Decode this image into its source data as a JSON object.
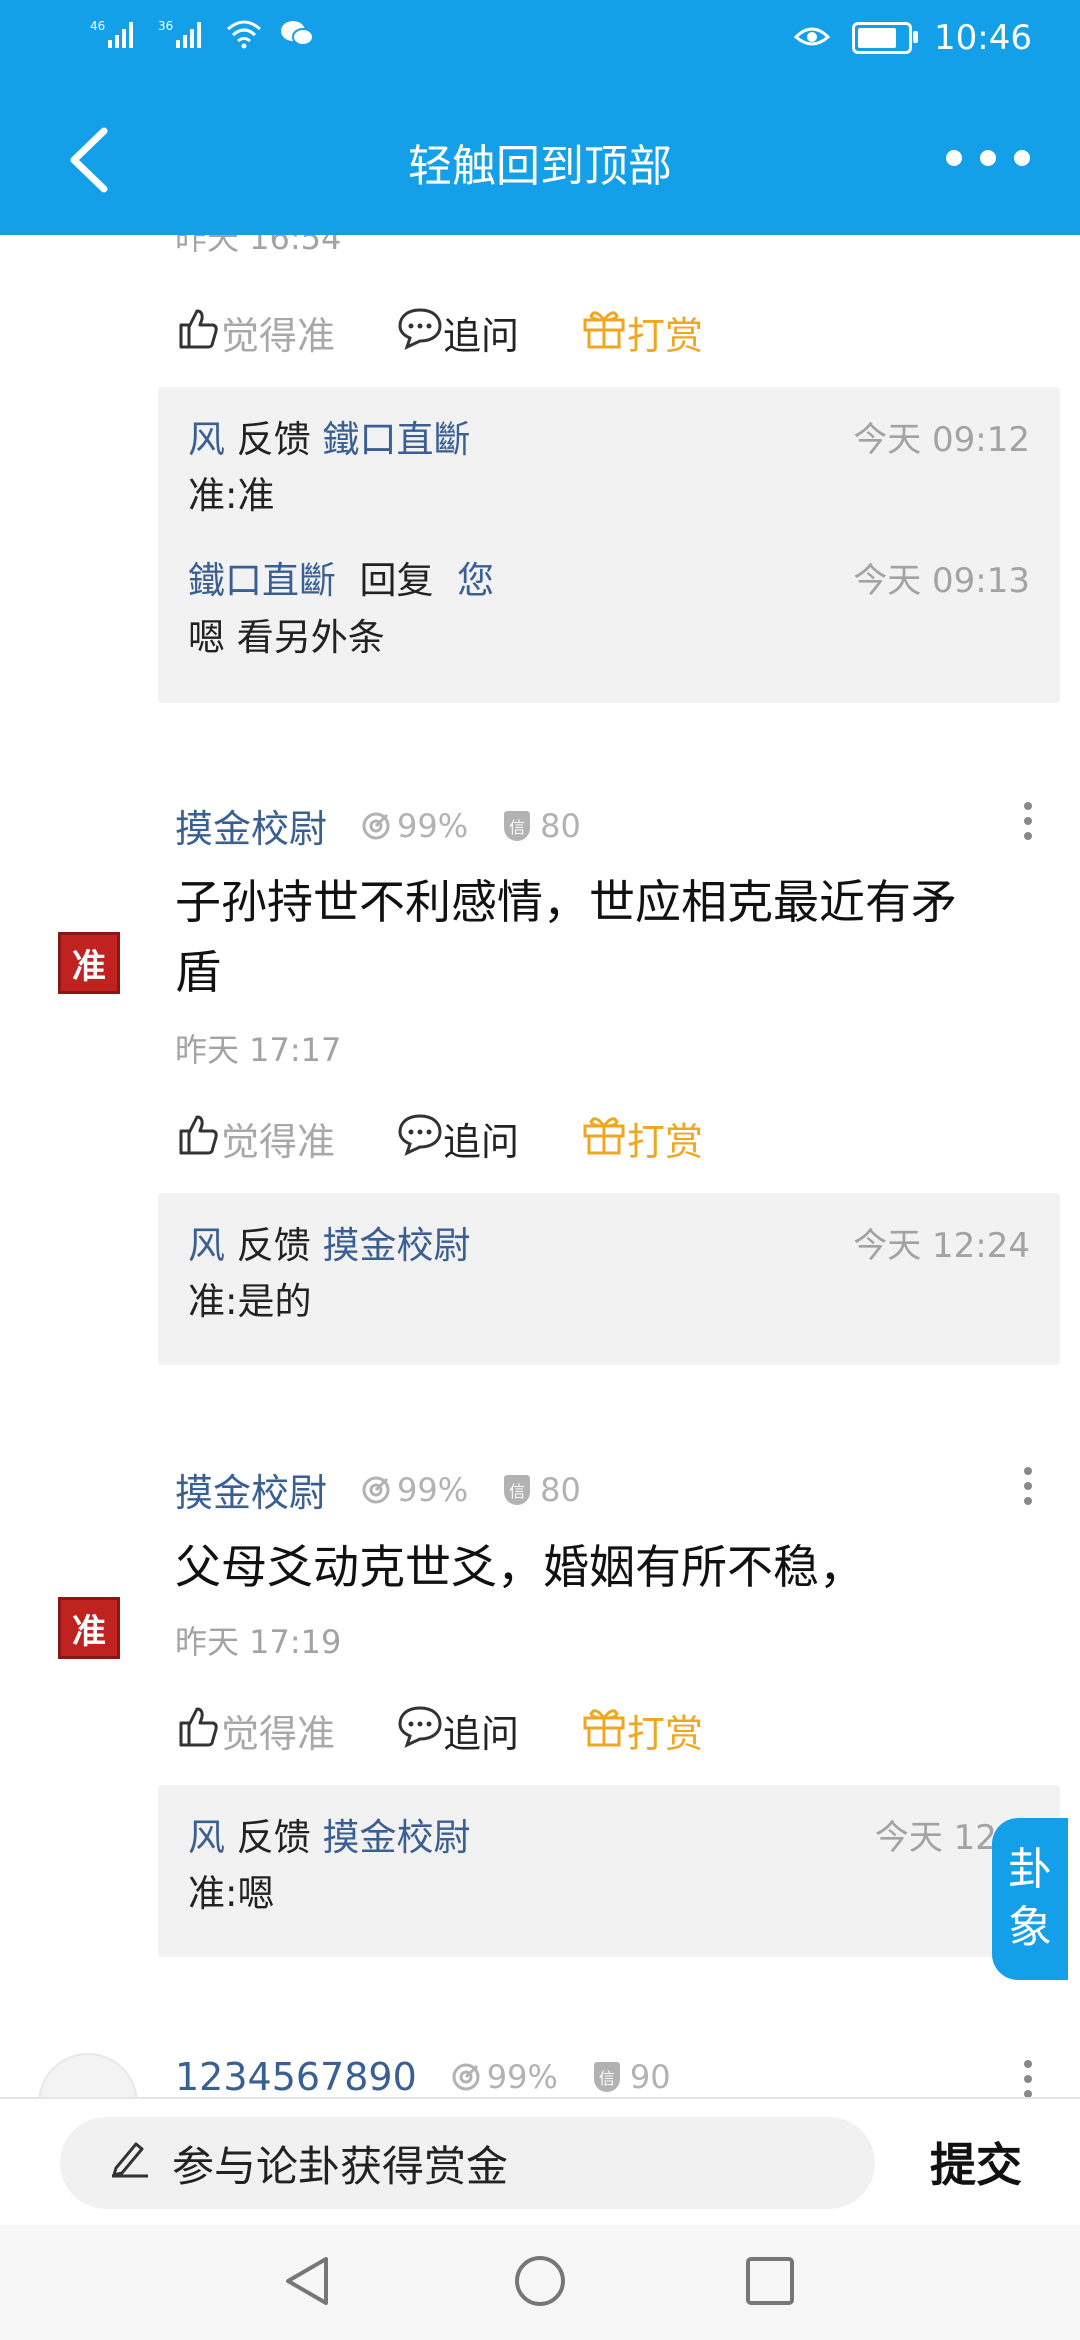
{
  "status_bar": {
    "signal1": "46",
    "signal2": "36",
    "time": "10:46",
    "battery_level": 0.9
  },
  "nav": {
    "title": "轻触回到顶部"
  },
  "top_partial": {
    "time": "昨天 16:54",
    "actions": {
      "agree": "觉得准",
      "ask": "追问",
      "reward": "打赏"
    },
    "replies": [
      {
        "user": "风",
        "verb": "反馈",
        "target": "鐵口直斷",
        "time": "今天 09:12",
        "text": "准:准"
      },
      {
        "user": "鐵口直斷",
        "verb": "回复",
        "target": "您",
        "time": "今天 09:13",
        "text": "嗯 看另外条"
      }
    ]
  },
  "posts": [
    {
      "username": "摸金校尉",
      "accuracy": "99%",
      "credit": "80",
      "seal": "准",
      "text_line1": "子孙持世不利感情，世应相克最近有矛",
      "text_line2": "盾",
      "time": "昨天 17:17",
      "actions": {
        "agree": "觉得准",
        "ask": "追问",
        "reward": "打赏"
      },
      "reply": {
        "user": "风",
        "verb": "反馈",
        "target": "摸金校尉",
        "time": "今天 12:24",
        "text": "准:是的"
      }
    },
    {
      "username": "摸金校尉",
      "accuracy": "99%",
      "credit": "80",
      "seal": "准",
      "text_line1": "父母爻动克世爻，婚姻有所不稳，",
      "time": "昨天 17:19",
      "actions": {
        "agree": "觉得准",
        "ask": "追问",
        "reward": "打赏"
      },
      "reply": {
        "user": "风",
        "verb": "反馈",
        "target": "摸金校尉",
        "time": "今天 12:2",
        "text": "准:嗯"
      }
    },
    {
      "username": "1234567890",
      "accuracy": "99%",
      "credit": "90"
    }
  ],
  "float_tab": {
    "line1": "卦",
    "line2": "象"
  },
  "compose": {
    "placeholder": "参与论卦获得赏金",
    "submit": "提交"
  },
  "icons": {
    "credit_badge": "信"
  },
  "colors": {
    "primary": "#14a0e8",
    "link": "#3a5f93",
    "reward": "#f0a720",
    "seal": "#c0221f"
  }
}
